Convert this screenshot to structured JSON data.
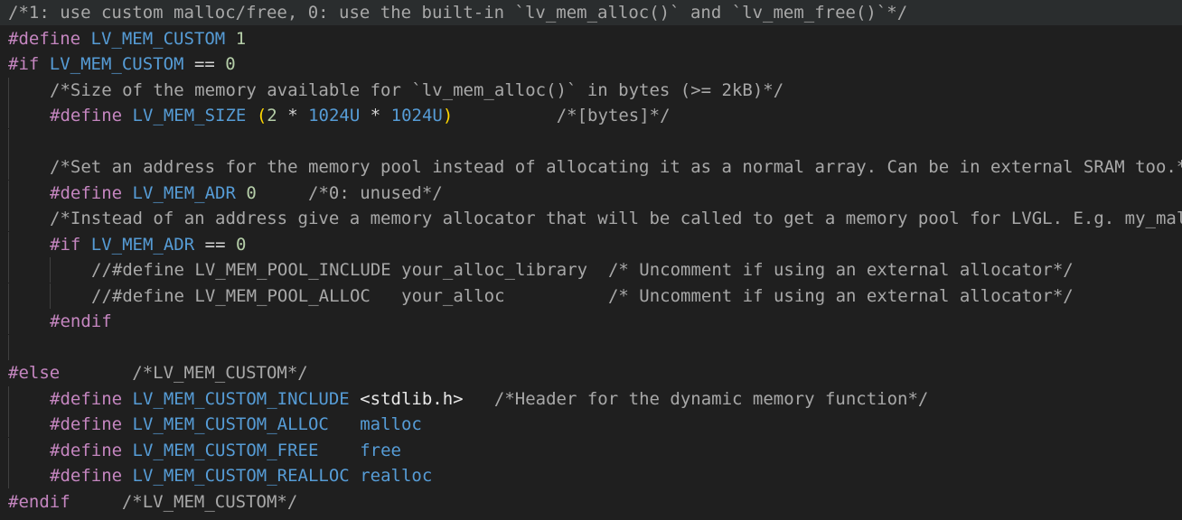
{
  "editor": {
    "lines": [
      {
        "indent": 0,
        "highlight": true,
        "tokens": [
          {
            "c": "comment",
            "t": "/*1: use custom malloc/free, 0: use the built-in `lv_mem_alloc()` and `lv_mem_free()`*/"
          }
        ]
      },
      {
        "indent": 0,
        "tokens": [
          {
            "c": "kw",
            "t": "#define"
          },
          {
            "c": "plain",
            "t": " "
          },
          {
            "c": "macro",
            "t": "LV_MEM_CUSTOM"
          },
          {
            "c": "plain",
            "t": " "
          },
          {
            "c": "num",
            "t": "1"
          }
        ]
      },
      {
        "indent": 0,
        "tokens": [
          {
            "c": "kw",
            "t": "#if"
          },
          {
            "c": "plain",
            "t": " "
          },
          {
            "c": "macro",
            "t": "LV_MEM_CUSTOM"
          },
          {
            "c": "plain",
            "t": " "
          },
          {
            "c": "op",
            "t": "=="
          },
          {
            "c": "plain",
            "t": " "
          },
          {
            "c": "num",
            "t": "0"
          }
        ]
      },
      {
        "indent": 1,
        "tokens": [
          {
            "c": "comment",
            "t": "/*Size of the memory available for `lv_mem_alloc()` in bytes (>= 2kB)*/"
          }
        ]
      },
      {
        "indent": 1,
        "tokens": [
          {
            "c": "kw",
            "t": "#define"
          },
          {
            "c": "plain",
            "t": " "
          },
          {
            "c": "macro",
            "t": "LV_MEM_SIZE"
          },
          {
            "c": "plain",
            "t": " "
          },
          {
            "c": "paren",
            "t": "("
          },
          {
            "c": "num",
            "t": "2"
          },
          {
            "c": "plain",
            "t": " "
          },
          {
            "c": "op",
            "t": "*"
          },
          {
            "c": "plain",
            "t": " "
          },
          {
            "c": "macro",
            "t": "1024U"
          },
          {
            "c": "plain",
            "t": " "
          },
          {
            "c": "op",
            "t": "*"
          },
          {
            "c": "plain",
            "t": " "
          },
          {
            "c": "macro",
            "t": "1024U"
          },
          {
            "c": "paren",
            "t": ")"
          },
          {
            "c": "plain",
            "t": "          "
          },
          {
            "c": "comment",
            "t": "/*[bytes]*/"
          }
        ]
      },
      {
        "indent": 1,
        "tokens": []
      },
      {
        "indent": 1,
        "tokens": [
          {
            "c": "comment",
            "t": "/*Set an address for the memory pool instead of allocating it as a normal array. Can be in external SRAM too.*/"
          }
        ]
      },
      {
        "indent": 1,
        "tokens": [
          {
            "c": "kw",
            "t": "#define"
          },
          {
            "c": "plain",
            "t": " "
          },
          {
            "c": "macro",
            "t": "LV_MEM_ADR"
          },
          {
            "c": "plain",
            "t": " "
          },
          {
            "c": "num",
            "t": "0"
          },
          {
            "c": "plain",
            "t": "     "
          },
          {
            "c": "comment",
            "t": "/*0: unused*/"
          }
        ]
      },
      {
        "indent": 1,
        "tokens": [
          {
            "c": "comment",
            "t": "/*Instead of an address give a memory allocator that will be called to get a memory pool for LVGL. E.g. my_malloc*/"
          }
        ]
      },
      {
        "indent": 1,
        "tokens": [
          {
            "c": "kw",
            "t": "#if"
          },
          {
            "c": "plain",
            "t": " "
          },
          {
            "c": "macro",
            "t": "LV_MEM_ADR"
          },
          {
            "c": "plain",
            "t": " "
          },
          {
            "c": "op",
            "t": "=="
          },
          {
            "c": "plain",
            "t": " "
          },
          {
            "c": "num",
            "t": "0"
          }
        ]
      },
      {
        "indent": 2,
        "tokens": [
          {
            "c": "comment",
            "t": "//#define LV_MEM_POOL_INCLUDE your_alloc_library  /* Uncomment if using an external allocator*/"
          }
        ]
      },
      {
        "indent": 2,
        "tokens": [
          {
            "c": "comment",
            "t": "//#define LV_MEM_POOL_ALLOC   your_alloc          /* Uncomment if using an external allocator*/"
          }
        ]
      },
      {
        "indent": 1,
        "tokens": [
          {
            "c": "kw",
            "t": "#endif"
          }
        ]
      },
      {
        "indent": 1,
        "tokens": []
      },
      {
        "indent": 0,
        "tokens": [
          {
            "c": "kw",
            "t": "#else"
          },
          {
            "c": "plain",
            "t": "       "
          },
          {
            "c": "comment",
            "t": "/*LV_MEM_CUSTOM*/"
          }
        ]
      },
      {
        "indent": 1,
        "tokens": [
          {
            "c": "kw",
            "t": "#define"
          },
          {
            "c": "plain",
            "t": " "
          },
          {
            "c": "macro",
            "t": "LV_MEM_CUSTOM_INCLUDE"
          },
          {
            "c": "plain",
            "t": " "
          },
          {
            "c": "hdr",
            "t": "<stdlib.h>"
          },
          {
            "c": "plain",
            "t": "   "
          },
          {
            "c": "comment",
            "t": "/*Header for the dynamic memory function*/"
          }
        ]
      },
      {
        "indent": 1,
        "tokens": [
          {
            "c": "kw",
            "t": "#define"
          },
          {
            "c": "plain",
            "t": " "
          },
          {
            "c": "macro",
            "t": "LV_MEM_CUSTOM_ALLOC"
          },
          {
            "c": "plain",
            "t": "   "
          },
          {
            "c": "ident",
            "t": "malloc"
          }
        ]
      },
      {
        "indent": 1,
        "tokens": [
          {
            "c": "kw",
            "t": "#define"
          },
          {
            "c": "plain",
            "t": " "
          },
          {
            "c": "macro",
            "t": "LV_MEM_CUSTOM_FREE"
          },
          {
            "c": "plain",
            "t": "    "
          },
          {
            "c": "ident",
            "t": "free"
          }
        ]
      },
      {
        "indent": 1,
        "tokens": [
          {
            "c": "kw",
            "t": "#define"
          },
          {
            "c": "plain",
            "t": " "
          },
          {
            "c": "macro",
            "t": "LV_MEM_CUSTOM_REALLOC"
          },
          {
            "c": "plain",
            "t": " "
          },
          {
            "c": "ident",
            "t": "realloc"
          }
        ]
      },
      {
        "indent": 0,
        "tokens": [
          {
            "c": "kw",
            "t": "#endif"
          },
          {
            "c": "plain",
            "t": "     "
          },
          {
            "c": "comment",
            "t": "/*LV_MEM_CUSTOM*/"
          }
        ]
      }
    ]
  }
}
